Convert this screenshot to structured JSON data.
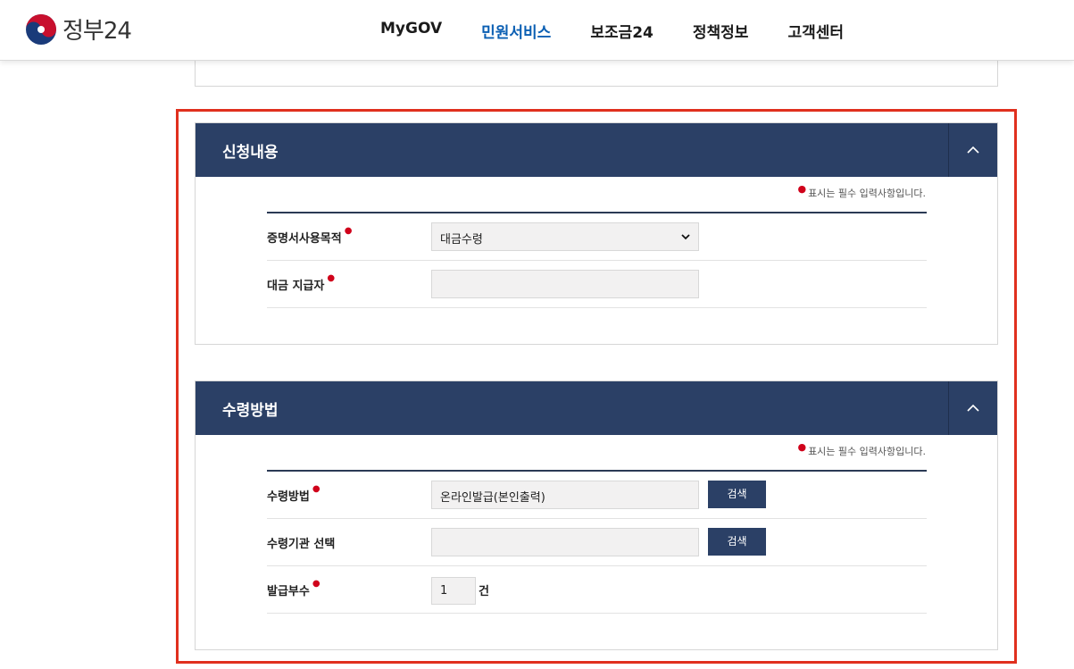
{
  "header": {
    "logo_text": "정부24",
    "nav": [
      {
        "label": "MyGOV"
      },
      {
        "label": "민원서비스"
      },
      {
        "label": "보조금24"
      },
      {
        "label": "정책정보"
      },
      {
        "label": "고객센터"
      }
    ],
    "active_nav": "민원서비스"
  },
  "colors": {
    "primary": "#2b4066",
    "active_nav": "#0b5fb3",
    "required": "#d0021b",
    "highlight_frame": "#e0301e"
  },
  "application": {
    "title": "신청내용",
    "required_note": "표시는 필수 입력사항입니다.",
    "purpose_label": "증명서사용목적",
    "purpose_value": "대금수령",
    "payer_label": "대금 지급자",
    "payer_value": ""
  },
  "receipt": {
    "title": "수령방법",
    "required_note": "표시는 필수 입력사항입니다.",
    "method_label": "수령방법",
    "method_value": "온라인발급(본인출력)",
    "search_label": "검색",
    "agency_label": "수령기관 선택",
    "agency_value": "",
    "copies_label": "발급부수",
    "copies_value": "1",
    "copies_unit": "건"
  }
}
